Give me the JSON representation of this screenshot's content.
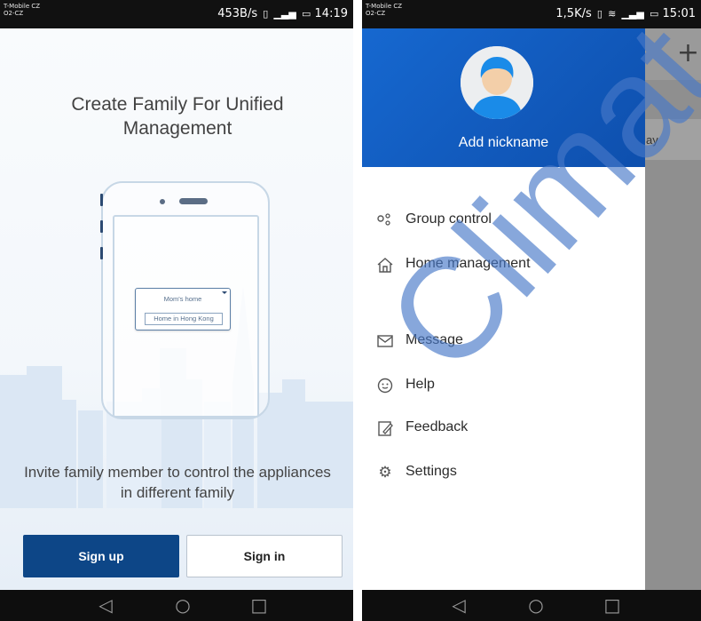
{
  "left_screen": {
    "status_bar": {
      "carrier_line1": "T-Mobile CZ",
      "carrier_line2": "O2-CZ",
      "info": "453B/s",
      "time": "14:19"
    },
    "heading": "Create Family For Unified Management",
    "illustration": {
      "option1": "Mom's home",
      "option2": "Home in Hong Kong"
    },
    "invite_text": "Invite family member to control the appliances in different family",
    "signup_label": "Sign up",
    "signin_label": "Sign in",
    "page_dots": {
      "count": 3,
      "active_index": 0
    }
  },
  "right_screen": {
    "status_bar": {
      "carrier_line1": "T-Mobile CZ",
      "carrier_line2": "O2-CZ",
      "info": "1,5K/s",
      "time": "15:01"
    },
    "background_app": {
      "add_icon": "plus-icon",
      "row_text": "ay"
    },
    "drawer": {
      "nickname_label": "Add nickname",
      "menu": [
        {
          "label": "Group control",
          "icon": "group-control-icon"
        },
        {
          "label": "Home management",
          "icon": "home-icon"
        },
        {
          "label": "Message",
          "icon": "envelope-icon"
        },
        {
          "label": "Help",
          "icon": "help-icon"
        },
        {
          "label": "Feedback",
          "icon": "feedback-icon"
        },
        {
          "label": "Settings",
          "icon": "gear-icon"
        }
      ]
    }
  },
  "navbar": {
    "back_icon": "back-icon",
    "home_icon": "home-button-icon",
    "recents_icon": "recents-icon"
  },
  "watermark": "Climat",
  "colors": {
    "brand_blue": "#0d4687",
    "drawer_blue": "#1668d0",
    "watermark": "#4678c8"
  }
}
